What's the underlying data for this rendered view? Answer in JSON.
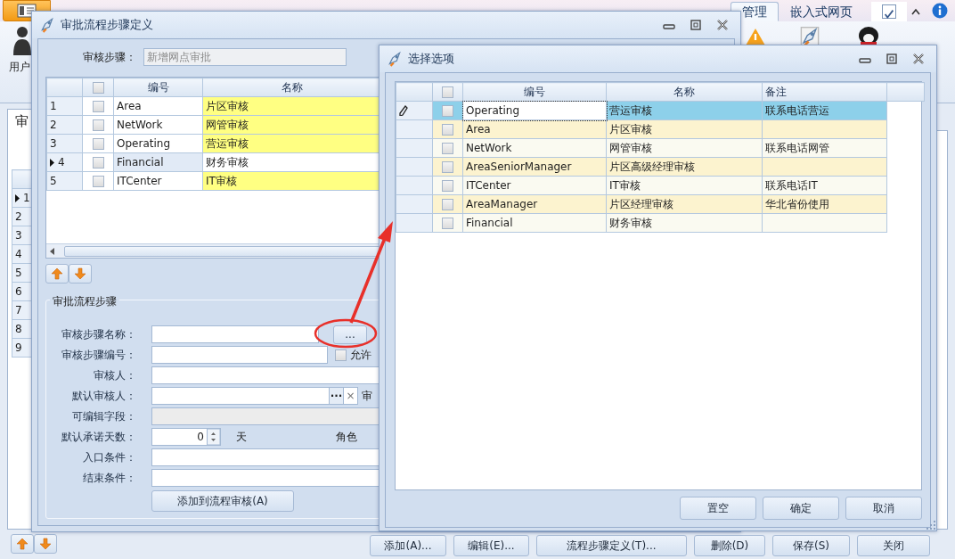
{
  "app": {
    "ribbon_tabs": [
      {
        "label": "管理",
        "selected": true
      },
      {
        "label": "嵌入式网页",
        "selected": false
      }
    ],
    "ribbon_checkbox": {
      "checked": true
    },
    "ribbon_item": {
      "label": "用户"
    },
    "side_tab": {
      "label": "审"
    },
    "side_grid": {
      "rows": [
        {
          "label": "1",
          "current": true
        },
        {
          "label": "2",
          "current": false
        },
        {
          "label": "3",
          "current": false
        },
        {
          "label": "4",
          "current": false
        },
        {
          "label": "5",
          "current": false
        },
        {
          "label": "6",
          "current": false
        },
        {
          "label": "7",
          "current": false
        },
        {
          "label": "8",
          "current": false
        },
        {
          "label": "9",
          "current": false
        }
      ]
    },
    "buttons": [
      "添加(A)...",
      "编辑(E)...",
      "流程步骤定义(T)...",
      "删除(D)",
      "保存(S)",
      "关闭"
    ]
  },
  "step_dialog": {
    "title": "审批流程步骤定义",
    "step_label": "审核步骤：",
    "step_value": "新增网点审批",
    "grid": {
      "select_all_checked": false,
      "columns": [
        "编号",
        "名称"
      ],
      "rows": [
        {
          "number": "1",
          "checked": false,
          "current": false,
          "highlighted": true,
          "code": "Area",
          "name": "片区审核"
        },
        {
          "number": "2",
          "checked": false,
          "current": false,
          "highlighted": true,
          "code": "NetWork",
          "name": "网管审核"
        },
        {
          "number": "3",
          "checked": false,
          "current": false,
          "highlighted": true,
          "code": "Operating",
          "name": "营运审核"
        },
        {
          "number": "4",
          "checked": false,
          "current": true,
          "highlighted": false,
          "code": "Financial",
          "name": "财务审核"
        },
        {
          "number": "5",
          "checked": false,
          "current": false,
          "highlighted": true,
          "code": "ITCenter",
          "name": "IT审核"
        }
      ]
    },
    "group_title": "审批流程步骤",
    "fields": [
      {
        "kind": "browse",
        "label": "审核步骤名称：",
        "button": "..."
      },
      {
        "kind": "check",
        "label": "审核步骤编号：",
        "check_label": "允许",
        "checked": false
      },
      {
        "kind": "text",
        "label": "审核人："
      },
      {
        "kind": "lookup",
        "label": "默认审核人：",
        "browse": "···",
        "clear": "×",
        "side_label": "审"
      },
      {
        "kind": "readonly",
        "label": "可编辑字段："
      },
      {
        "kind": "spin",
        "label": "默认承诺天数：",
        "value": "0",
        "unit": "天",
        "side_label": "角色"
      },
      {
        "kind": "text",
        "label": "入口条件："
      },
      {
        "kind": "text",
        "label": "结束条件："
      }
    ],
    "add_button": "添加到流程审核(A)"
  },
  "select_dialog": {
    "title": "选择选项",
    "select_all_checked": false,
    "columns": [
      "编号",
      "名称",
      "备注"
    ],
    "rows": [
      {
        "selected": true,
        "checked": false,
        "code": "Operating",
        "name": "营运审核",
        "note": "联系电话营运"
      },
      {
        "selected": false,
        "checked": false,
        "code": "Area",
        "name": "片区审核"
      },
      {
        "selected": false,
        "checked": false,
        "code": "NetWork",
        "name": "网管审核",
        "note": "联系电话网管"
      },
      {
        "selected": false,
        "checked": false,
        "code": "AreaSeniorManager",
        "name": "片区高级经理审核"
      },
      {
        "selected": false,
        "checked": false,
        "code": "ITCenter",
        "name": "IT审核",
        "note": "联系电话IT"
      },
      {
        "selected": false,
        "checked": false,
        "code": "AreaManager",
        "name": "片区经理审核",
        "note": "华北省份使用"
      },
      {
        "selected": false,
        "checked": false,
        "code": "Financial",
        "name": "财务审核"
      }
    ],
    "buttons": [
      "置空",
      "确定",
      "取消"
    ]
  }
}
